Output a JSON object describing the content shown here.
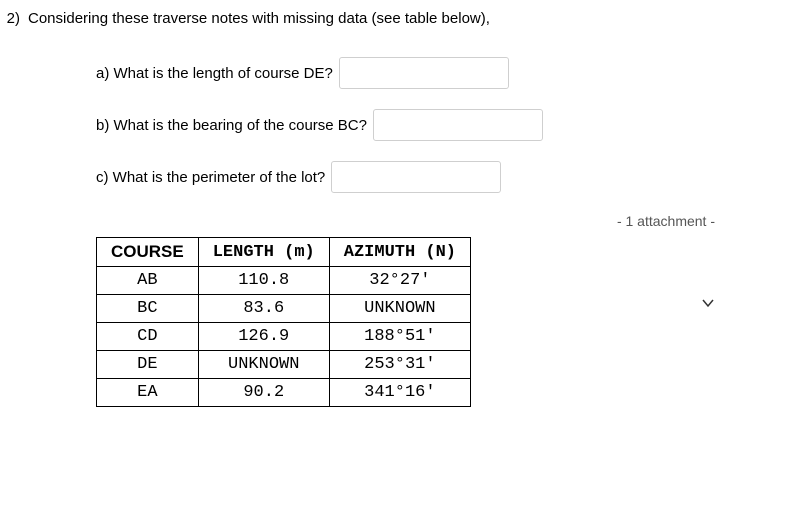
{
  "question": {
    "number": "2)",
    "prompt": "Considering these traverse notes with missing data (see table below),"
  },
  "subs": {
    "a": {
      "label": "a) What is the length of course DE?",
      "value": ""
    },
    "b": {
      "label": "b) What is the bearing of the course BC?",
      "value": ""
    },
    "c": {
      "label": "c) What is the perimeter of the lot?",
      "value": ""
    }
  },
  "attachment_text": "- 1 attachment -",
  "chart_data": {
    "type": "table",
    "headers": {
      "course": "COURSE",
      "length": "LENGTH (m)",
      "azimuth": "AZIMUTH (N)"
    },
    "rows": [
      {
        "course": "AB",
        "length": "110.8",
        "azimuth": "32°27'"
      },
      {
        "course": "BC",
        "length": "83.6",
        "azimuth": "UNKNOWN"
      },
      {
        "course": "CD",
        "length": "126.9",
        "azimuth": "188°51'"
      },
      {
        "course": "DE",
        "length": "UNKNOWN",
        "azimuth": "253°31'"
      },
      {
        "course": "EA",
        "length": "90.2",
        "azimuth": "341°16'"
      }
    ]
  }
}
